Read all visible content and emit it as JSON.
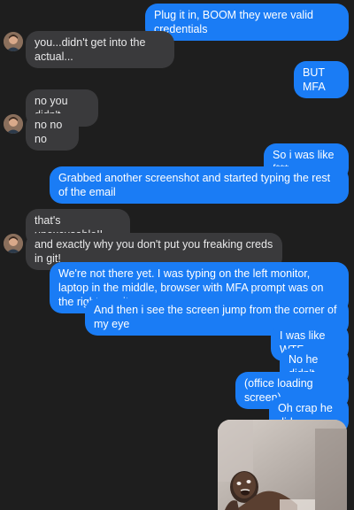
{
  "conversation": {
    "messages": [
      {
        "from": "me",
        "text": "Plug it in, BOOM they were valid credentials"
      },
      {
        "from": "them",
        "text": "you...didn't get into the actual..."
      },
      {
        "from": "me",
        "text": "BUT MFA"
      },
      {
        "from": "them",
        "text": "no you didn't"
      },
      {
        "from": "them",
        "text": "no no no"
      },
      {
        "from": "me",
        "text": "So i was like f***"
      },
      {
        "from": "me",
        "text": "Grabbed another screenshot and started typing the rest of the email"
      },
      {
        "from": "them",
        "text": "that's unexcusable!!"
      },
      {
        "from": "them",
        "text": "and exactly why you don't put you freaking creds in git!"
      },
      {
        "from": "me",
        "text": "We're not there yet. I was typing on the left monitor, laptop in the middle, browser with MFA prompt was on the right monitor"
      },
      {
        "from": "me",
        "text": "And then i see the screen jump from the corner of my eye"
      },
      {
        "from": "me",
        "text": "I was like WTF"
      },
      {
        "from": "me",
        "text": "No he didn't"
      },
      {
        "from": "me",
        "text": "(office loading screen)"
      },
      {
        "from": "me",
        "text": "Oh crap he did"
      }
    ]
  },
  "colors": {
    "background": "#1e1e1e",
    "outgoing_bubble": "#1a7cf5",
    "incoming_bubble": "#3a3a3c"
  },
  "icons": {
    "avatar": "contact-avatar",
    "attachment": "reaction-photo"
  }
}
